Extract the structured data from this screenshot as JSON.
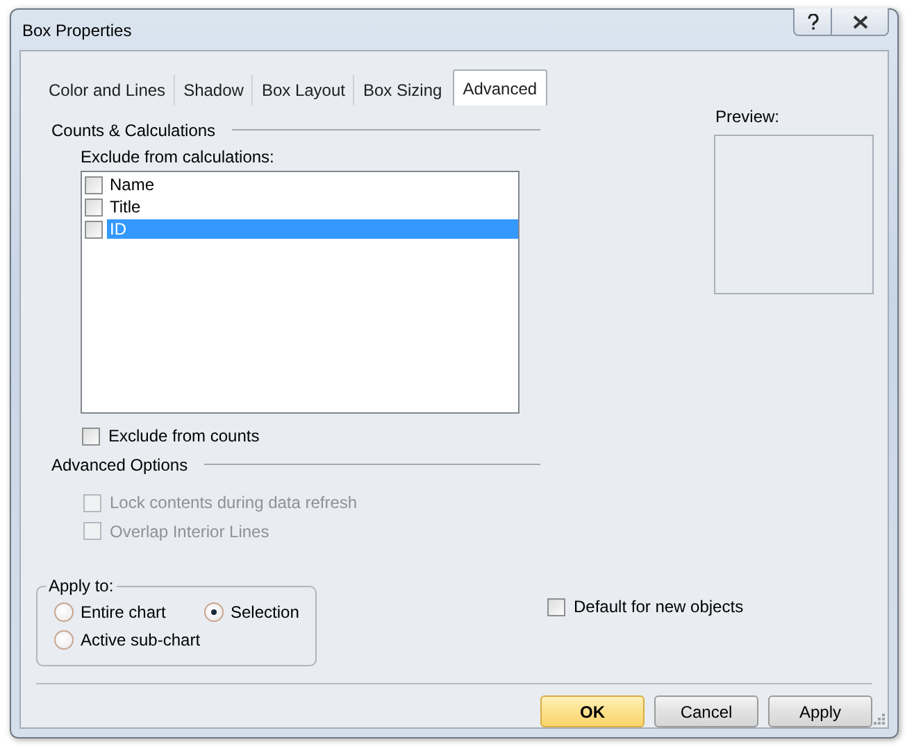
{
  "window": {
    "title": "Box Properties"
  },
  "tabs": [
    {
      "label": "Color and Lines",
      "selected": false
    },
    {
      "label": "Shadow",
      "selected": false
    },
    {
      "label": "Box Layout",
      "selected": false
    },
    {
      "label": "Box Sizing",
      "selected": false
    },
    {
      "label": "Advanced",
      "selected": true
    }
  ],
  "counts_section": {
    "heading": "Counts & Calculations",
    "list_label": "Exclude from calculations:",
    "items": [
      {
        "label": "Name",
        "checked": false,
        "selected": false
      },
      {
        "label": "Title",
        "checked": false,
        "selected": false
      },
      {
        "label": "ID",
        "checked": false,
        "selected": true
      }
    ],
    "exclude_from_counts": {
      "label": "Exclude from counts",
      "checked": false
    }
  },
  "advanced_options": {
    "heading": "Advanced Options",
    "options": [
      {
        "label": "Lock contents during data refresh",
        "checked": false,
        "disabled": true
      },
      {
        "label": "Overlap Interior Lines",
        "checked": false,
        "disabled": true
      }
    ]
  },
  "preview": {
    "label": "Preview:"
  },
  "apply_to": {
    "label": "Apply to:",
    "options": [
      {
        "label": "Entire chart",
        "selected": false
      },
      {
        "label": "Selection",
        "selected": true
      },
      {
        "label": "Active sub-chart",
        "selected": false
      }
    ]
  },
  "default_for_new": {
    "label": "Default for new objects",
    "checked": false
  },
  "buttons": [
    {
      "label": "OK",
      "default": true
    },
    {
      "label": "Cancel",
      "default": false
    },
    {
      "label": "Apply",
      "default": false
    }
  ]
}
